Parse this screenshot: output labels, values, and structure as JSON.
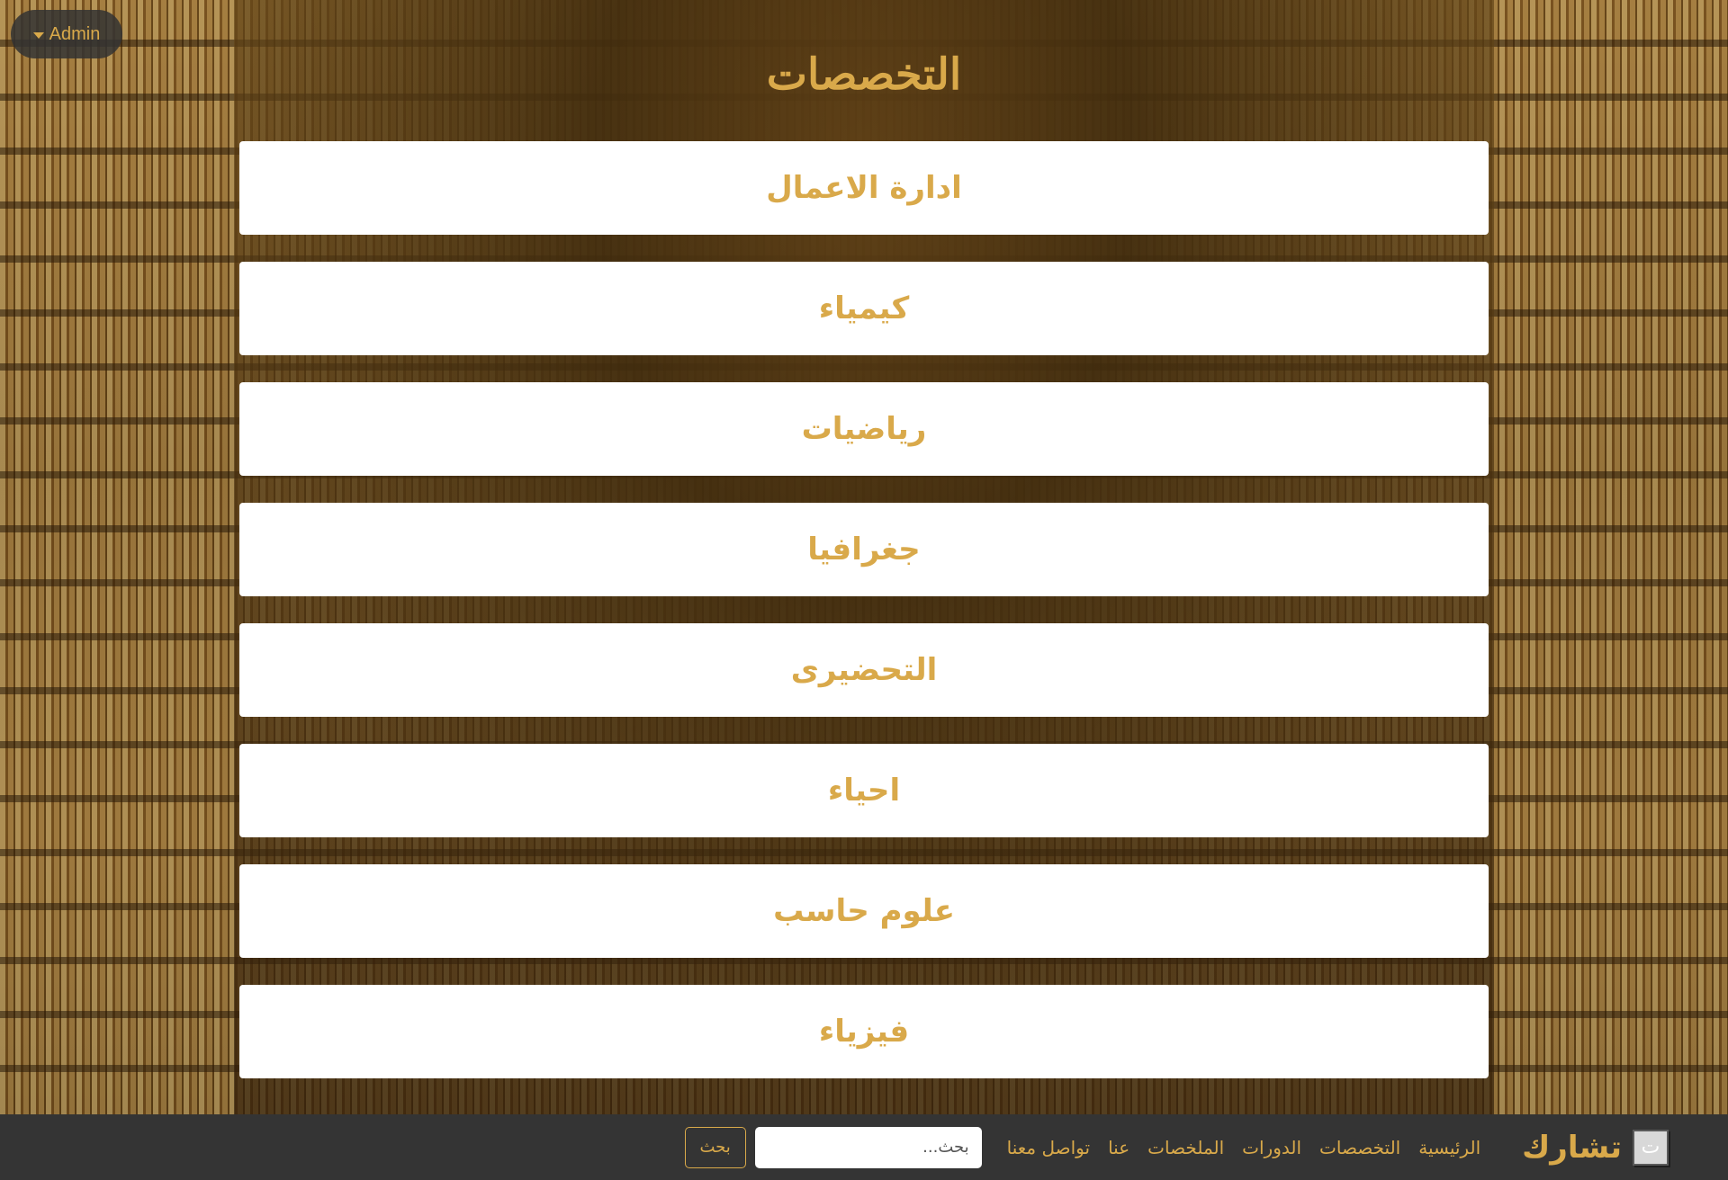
{
  "admin_menu": {
    "label": "Admin"
  },
  "page_title": "التخصصات",
  "specializations": [
    {
      "label": "ادارة الاعمال"
    },
    {
      "label": "كيمياء"
    },
    {
      "label": "رياضيات"
    },
    {
      "label": "جغرافيا"
    },
    {
      "label": "التحضيرى"
    },
    {
      "label": "احياء"
    },
    {
      "label": "علوم حاسب"
    },
    {
      "label": "فيزياء"
    }
  ],
  "navbar": {
    "brand_name": "تشارك",
    "brand_logo_char": "ت",
    "links": [
      {
        "label": "الرئيسية"
      },
      {
        "label": "التخصصات"
      },
      {
        "label": "الدورات"
      },
      {
        "label": "الملخصات"
      },
      {
        "label": "عنا"
      },
      {
        "label": "تواصل معنا"
      }
    ],
    "search_placeholder": "بحث...",
    "search_button": "بحث"
  },
  "colors": {
    "accent": "#d9a94a",
    "navbar_bg": "#343434",
    "card_bg": "#ffffff"
  }
}
